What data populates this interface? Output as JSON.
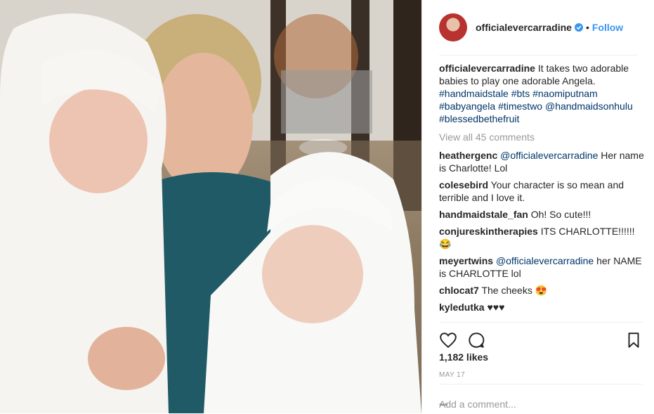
{
  "post": {
    "username": "officialevercarradine",
    "follow_label": "Follow",
    "separator": "•",
    "caption": {
      "text": "It takes two adorable babies to play one adorable Angela.",
      "hashtags": "#handmaidstale #bts #naomiputnam #babyangela #timestwo @handmaidsonhulu #blessedbethefruit"
    },
    "view_all_comments": "View all 45 comments",
    "comments": [
      {
        "user": "heatherg enc",
        "mention": "@officialevercarradine",
        "text": " Her name is Charlotte! Lol"
      },
      {
        "user": "colesebird",
        "mention": "",
        "text": " Your character is so mean and terrible and I love it."
      },
      {
        "user": "handmaidstale_fan",
        "mention": "",
        "text": " Oh! So cute!!!"
      },
      {
        "user": "conjureskintherapies",
        "mention": "",
        "text": " ITS CHARLOTTE!!!!!! 😂"
      },
      {
        "user": "meyertwins",
        "mention": "@officialevercarradine",
        "text": " her NAME is CHARLOTTE lol"
      },
      {
        "user": "chlocat7",
        "mention": "",
        "text": " The cheeks 😍"
      },
      {
        "user": "kyledutka",
        "mention": "",
        "text": " ♥♥♥"
      }
    ],
    "likes": "1,182 likes",
    "date": "MAY 17",
    "add_comment_placeholder": "Add a comment...",
    "more_label": "•••",
    "icons": {
      "like": "heart-icon",
      "comment": "comment-bubble-icon",
      "save": "bookmark-icon",
      "verified": "verified-badge-icon"
    },
    "colors": {
      "link": "#003569",
      "follow": "#3897f0",
      "muted": "#999999"
    }
  }
}
